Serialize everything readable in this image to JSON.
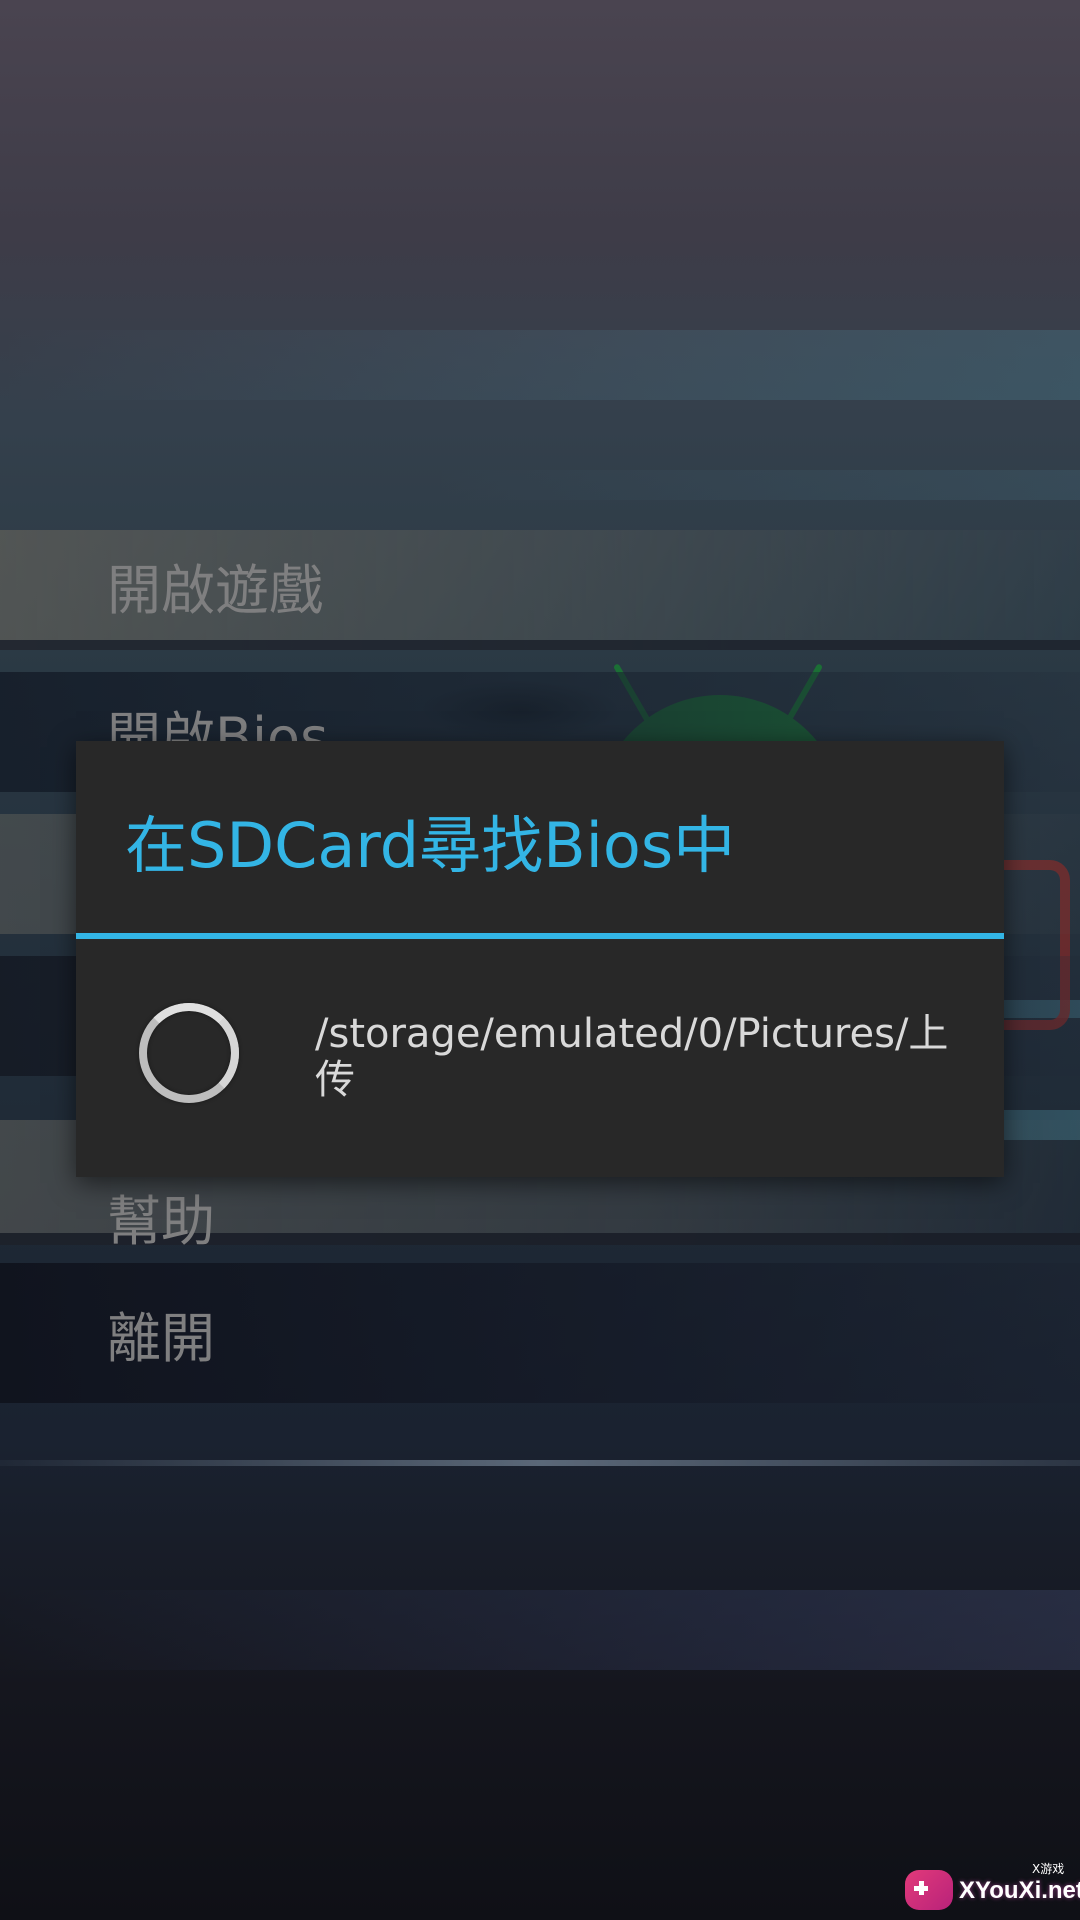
{
  "menu": {
    "items": [
      {
        "label": "開啟遊戲"
      },
      {
        "label": "開啟Bios"
      },
      {
        "label": ""
      },
      {
        "label": ""
      },
      {
        "label": "幫助"
      },
      {
        "label": "離開"
      }
    ]
  },
  "dialog": {
    "title": "在SDCard尋找Bios中",
    "message": "/storage/emulated/0/Pictures/上传",
    "accent_color": "#33b5e5",
    "spinner_icon": "loading-spinner-icon"
  },
  "watermark": {
    "text": "XYouXi.net",
    "sub": "X游戏"
  }
}
